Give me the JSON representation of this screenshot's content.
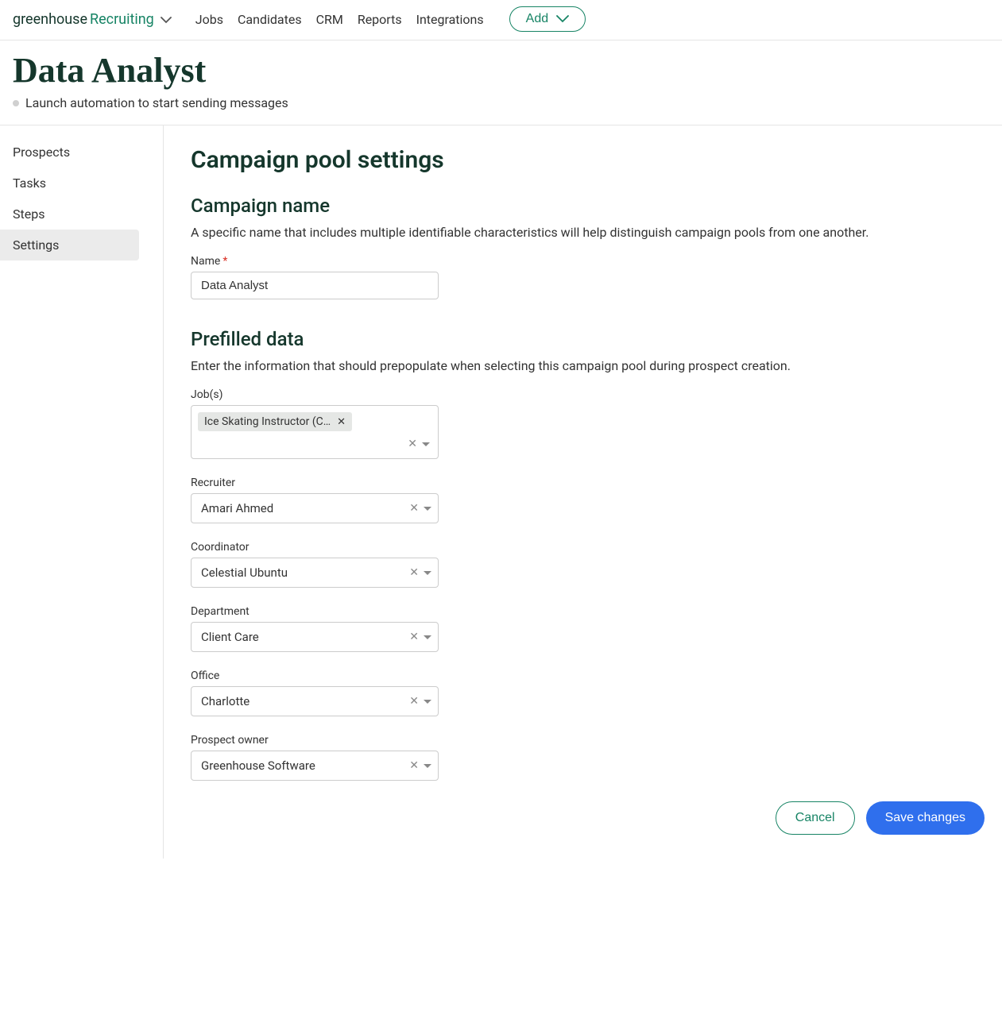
{
  "header": {
    "logo_part1": "greenhouse",
    "logo_part2": "Recruiting",
    "nav": [
      "Jobs",
      "Candidates",
      "CRM",
      "Reports",
      "Integrations"
    ],
    "add_label": "Add"
  },
  "page": {
    "title": "Data Analyst",
    "subtitle": "Launch automation to start sending messages"
  },
  "sidebar": {
    "items": [
      "Prospects",
      "Tasks",
      "Steps",
      "Settings"
    ],
    "active_index": 3
  },
  "main": {
    "title": "Campaign pool settings",
    "campaign_name": {
      "heading": "Campaign name",
      "desc": "A specific name that includes multiple identifiable characteristics will help distinguish campaign pools from one another.",
      "label": "Name",
      "value": "Data Analyst"
    },
    "prefilled": {
      "heading": "Prefilled data",
      "desc": "Enter the information that should prepopulate when selecting this campaign pool during prospect creation.",
      "jobs": {
        "label": "Job(s)",
        "chips": [
          "Ice Skating Instructor (C…"
        ]
      },
      "recruiter": {
        "label": "Recruiter",
        "value": "Amari Ahmed"
      },
      "coordinator": {
        "label": "Coordinator",
        "value": "Celestial Ubuntu"
      },
      "department": {
        "label": "Department",
        "value": "Client Care"
      },
      "office": {
        "label": "Office",
        "value": "Charlotte"
      },
      "prospect_owner": {
        "label": "Prospect owner",
        "value": "Greenhouse Software"
      }
    },
    "footer": {
      "cancel": "Cancel",
      "save": "Save changes"
    }
  }
}
